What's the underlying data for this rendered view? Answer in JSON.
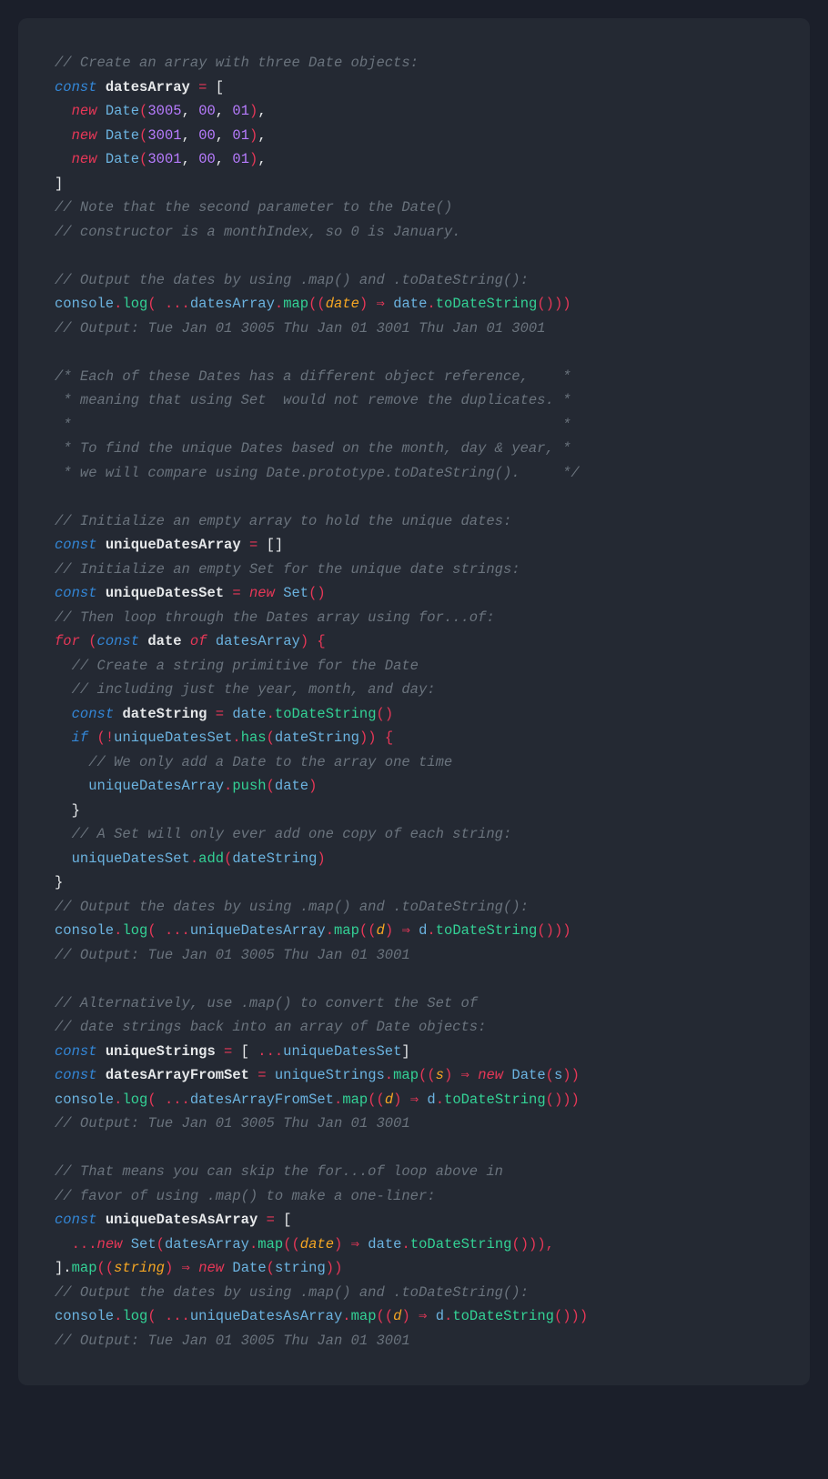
{
  "code": {
    "c01": "// Create an array with three Date objects:",
    "const": "const",
    "datesArray": "datesArray",
    "eq": " = ",
    "lbrack": "[",
    "indent": "  ",
    "indent2": "    ",
    "new": "new",
    "sp": " ",
    "Date": "Date",
    "lp": "(",
    "rp": ")",
    "n3005": "3005",
    "comma": ", ",
    "n00": "00",
    "n01": "01",
    "commatrail": ",",
    "n3001": "3001",
    "rbrack": "]",
    "c02": "// Note that the second parameter to the Date()",
    "c03": "// constructor is a monthIndex, so 0 is January.",
    "c04": "// Output the dates by using .map() and .toDateString():",
    "console": "console",
    "dot": ".",
    "log": "log",
    "lpsp": "( ",
    "spread": "...",
    "map": "map",
    "lpp": "((",
    "date_param": "date",
    "rpsp": ") ",
    "arrow": "⇒",
    "dateVar": "date",
    "toDateString": "toDateString",
    "rp3": "()))",
    "c05": "// Output: Tue Jan 01 3005 Thu Jan 01 3001 Thu Jan 01 3001",
    "c06": "/* Each of these Dates has a different object reference,    *",
    "c07": " * meaning that using Set  would not remove the duplicates. *",
    "c08": " *                                                          *",
    "c09": " * To find the unique Dates based on the month, day & year, *",
    "c10": " * we will compare using Date.prototype.toDateString().     */",
    "c11": "// Initialize an empty array to hold the unique dates:",
    "uniqueDatesArray": "uniqueDatesArray",
    "emptyArr": "[]",
    "c12": "// Initialize an empty Set for the unique date strings:",
    "uniqueDatesSet": "uniqueDatesSet",
    "Set": "Set",
    "rp0": "()",
    "c13": "// Then loop through the Dates array using for...of:",
    "for": "for",
    "of": "of",
    "dateId": "date",
    "rpbr": ") {",
    "c14": "// Create a string primitive for the Date",
    "c15": "// including just the year, month, and day:",
    "dateString": "dateString",
    "if": "if",
    "bang": "!",
    "has": "has",
    "rpp": ")) {",
    "c16": "// We only add a Date to the array one time",
    "push": "push",
    "rp1": ")",
    "rbrace": "}",
    "c17": "// A Set will only ever add one copy of each string:",
    "add": "add",
    "c18": "// Output the dates by using .map() and .toDateString():",
    "d_param": "d",
    "dVar": "d",
    "c19": "// Output: Tue Jan 01 3005 Thu Jan 01 3001",
    "c20": "// Alternatively, use .map() to convert the Set of",
    "c21": "// date strings back into an array of Date objects:",
    "uniqueStrings": "uniqueStrings",
    "lbracksp": "[ ",
    "datesArrayFromSet": "datesArrayFromSet",
    "s_param": "s",
    "sVar": "s",
    "rp2": "))",
    "c22": "// Output: Tue Jan 01 3005 Thu Jan 01 3001",
    "c23": "// That means you can skip the for...of loop above in",
    "c24": "// favor of using .map() to make a one-liner:",
    "uniqueDatesAsArray": "uniqueDatesAsArray",
    "rp3c": "())),",
    "rbrackdot": "].",
    "string_param": "string",
    "stringVar": "string",
    "c25": "// Output the dates by using .map() and .toDateString():",
    "c26": "// Output: Tue Jan 01 3005 Thu Jan 01 3001"
  }
}
